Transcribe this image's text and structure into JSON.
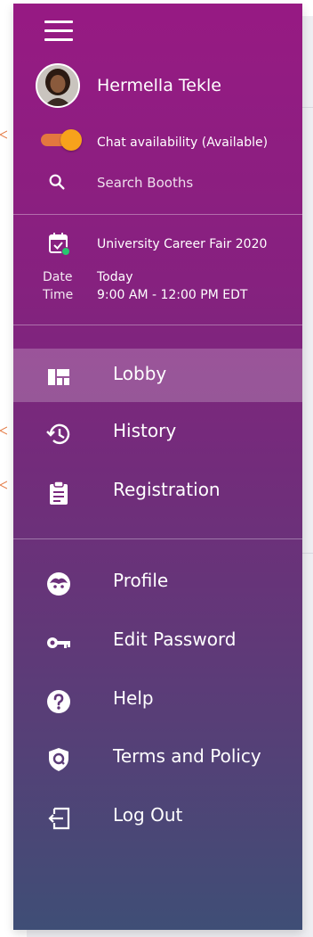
{
  "user": {
    "name": "Hermella Tekle"
  },
  "chat": {
    "label": "Chat availability (Available)",
    "enabled": true
  },
  "search": {
    "label": "Search Booths"
  },
  "event": {
    "title": "University Career Fair 2020",
    "date_label": "Date",
    "date_value": "Today",
    "time_label": "Time",
    "time_value": "9:00 AM - 12:00 PM EDT"
  },
  "nav_primary": [
    {
      "label": "Lobby",
      "icon": "lobby-icon",
      "active": true
    },
    {
      "label": "History",
      "icon": "history-icon"
    },
    {
      "label": "Registration",
      "icon": "clipboard-icon"
    }
  ],
  "nav_secondary": [
    {
      "label": "Profile",
      "icon": "face-icon"
    },
    {
      "label": "Edit Password",
      "icon": "key-icon"
    },
    {
      "label": "Help",
      "icon": "help-icon"
    },
    {
      "label": "Terms and Policy",
      "icon": "shield-icon"
    },
    {
      "label": "Log Out",
      "icon": "logout-icon"
    }
  ],
  "colors": {
    "drawer_top": "#971a83",
    "drawer_bottom": "#3f4e76",
    "toggle_track": "#e3773f",
    "toggle_knob": "#f7a21c",
    "online_dot": "#28c76f"
  }
}
